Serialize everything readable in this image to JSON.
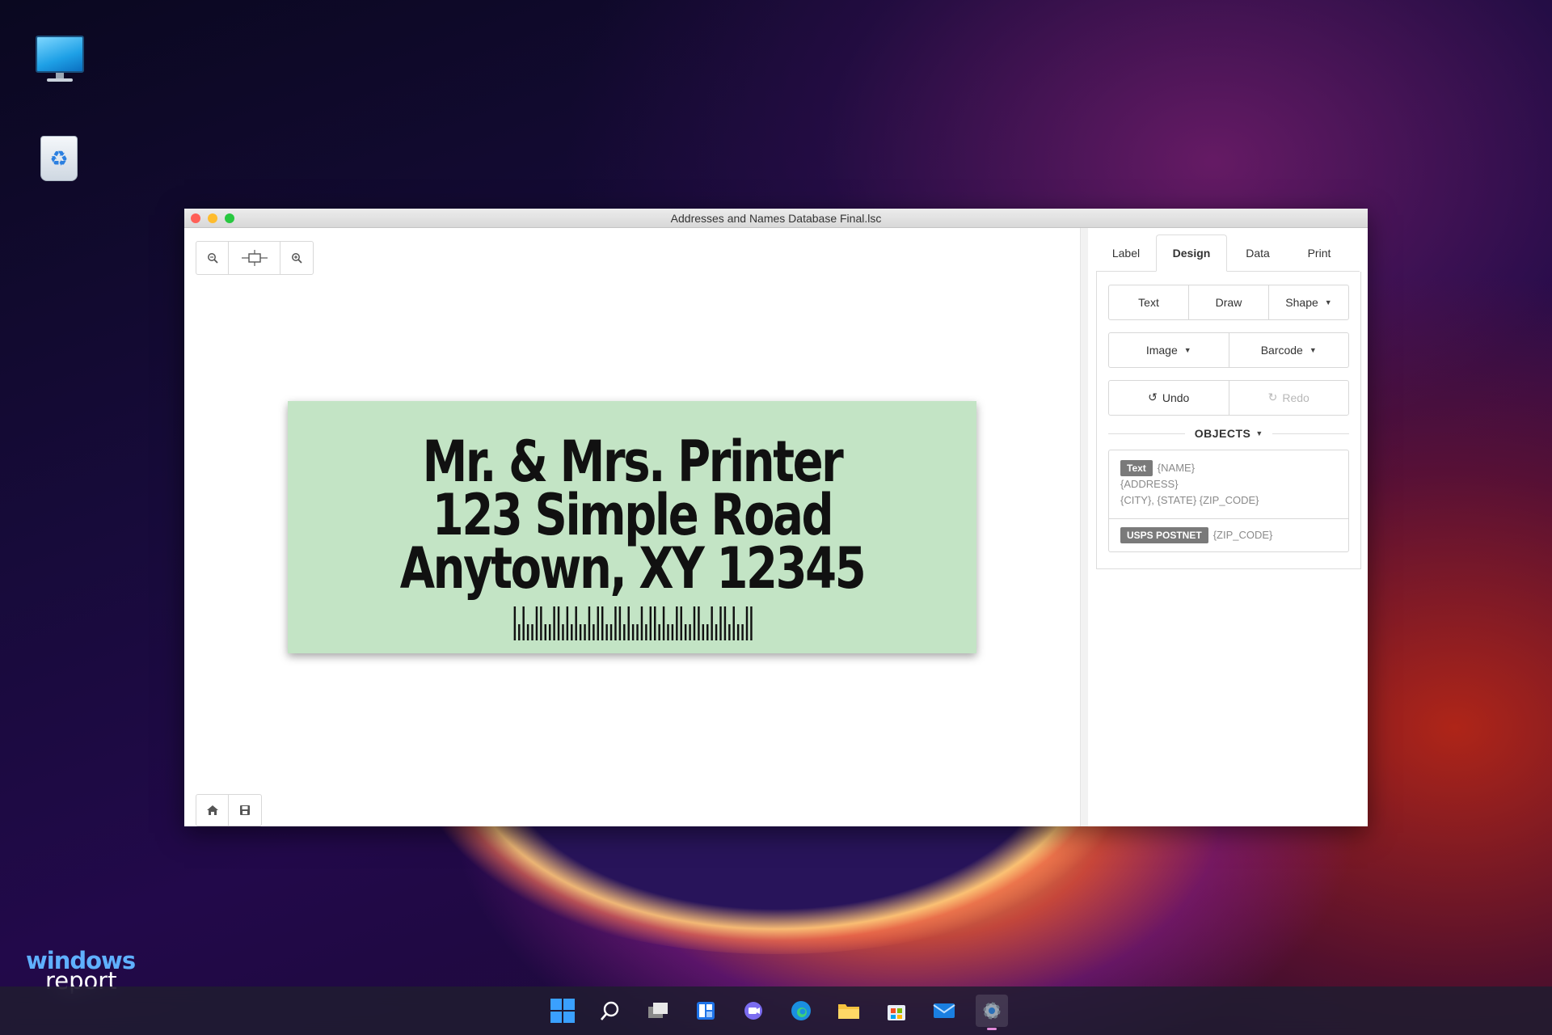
{
  "window": {
    "title": "Addresses and Names Database Final.lsc"
  },
  "canvas": {
    "label_lines": [
      "Mr. & Mrs. Printer",
      "123 Simple Road",
      "Anytown, XY 12345"
    ],
    "background_color": "#c3e4c5"
  },
  "panel": {
    "tabs": [
      "Label",
      "Design",
      "Data",
      "Print"
    ],
    "active_tab": "Design",
    "buttons": {
      "text": "Text",
      "draw": "Draw",
      "shape": "Shape",
      "image": "Image",
      "barcode": "Barcode",
      "undo": "Undo",
      "redo": "Redo"
    },
    "objects_header": "OBJECTS",
    "objects": [
      {
        "type": "Text",
        "lines": [
          "{NAME}",
          "{ADDRESS}",
          "{CITY}, {STATE} {ZIP_CODE}"
        ]
      },
      {
        "type": "USPS POSTNET",
        "lines": [
          "{ZIP_CODE}"
        ]
      }
    ]
  },
  "watermark": {
    "line1": "windows",
    "line2": "report"
  },
  "icons": {
    "zoom_out": "zoom-out-icon",
    "fit": "fit-to-screen-icon",
    "zoom_in": "zoom-in-icon",
    "home": "home-icon",
    "save": "save-icon"
  },
  "colors": {
    "accent_badge": "#7a7a7a",
    "close": "#ff5f57",
    "minimize": "#febc2e",
    "maximize": "#28c840"
  }
}
